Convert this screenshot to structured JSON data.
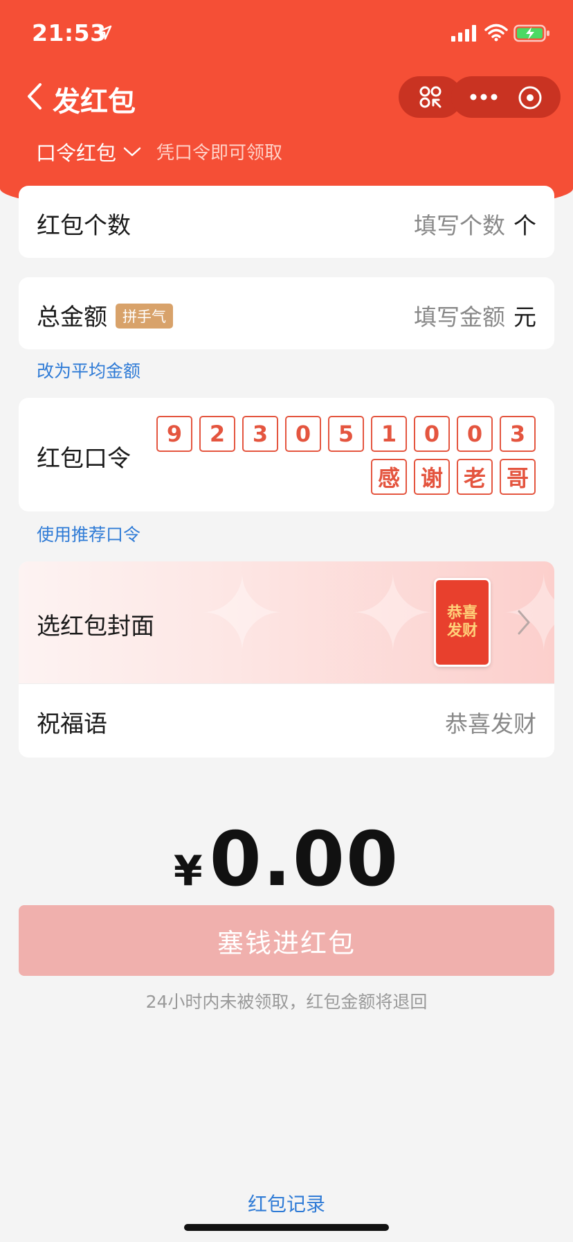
{
  "status_bar": {
    "time": "21:53"
  },
  "nav": {
    "title": "发红包"
  },
  "envelope_type": {
    "selected": "口令红包",
    "hint": "凭口令即可领取"
  },
  "count_row": {
    "label": "红包个数",
    "placeholder": "填写个数",
    "unit": "个"
  },
  "total_row": {
    "label": "总金额",
    "badge": "拼手气",
    "placeholder": "填写金额",
    "unit": "元"
  },
  "switch_average_link": "改为平均金额",
  "password_row": {
    "label": "红包口令",
    "characters_line1": [
      "9",
      "2",
      "3",
      "0",
      "5",
      "1",
      "0",
      "0",
      "3"
    ],
    "characters_line2": [
      "感",
      "谢",
      "老",
      "哥"
    ]
  },
  "recommended_password_link": "使用推荐口令",
  "cover_row": {
    "label": "选红包封面",
    "thumb_line1": "恭喜",
    "thumb_line2": "发财"
  },
  "greeting_row": {
    "label": "祝福语",
    "placeholder": "恭喜发财"
  },
  "amount": {
    "currency": "¥",
    "value": "0.00"
  },
  "submit_button": "塞钱进红包",
  "refund_note": "24小时内未被领取，红包金额将退回",
  "records_link": "红包记录",
  "colors": {
    "header": "#f54f36",
    "accent": "#e4553f",
    "link": "#2f7bd6",
    "button_disabled": "#f0b0ad"
  }
}
